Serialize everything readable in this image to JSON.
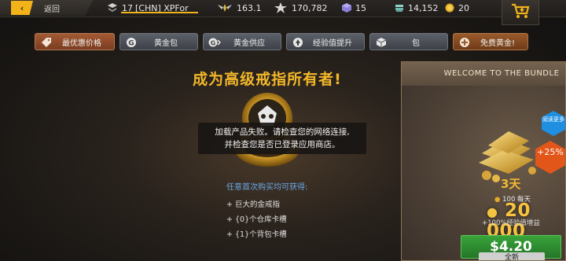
{
  "topbar": {
    "back_label": "返回",
    "player": {
      "level": "17",
      "name": "[CHN] XPFor"
    },
    "rank_value": "163.1",
    "rating_value": "170,782",
    "tickets_value": "15",
    "silver_value": "14,152",
    "gold_value": "20"
  },
  "tabs": [
    {
      "label": "最优惠价格",
      "icon": "sale-tag-icon"
    },
    {
      "label": "黄金包",
      "icon": "gold-coin-g-icon"
    },
    {
      "label": "黄金供应",
      "icon": "gold-supply-icon"
    },
    {
      "label": "经验值提升",
      "icon": "xp-boost-icon"
    },
    {
      "label": "包",
      "icon": "package-box-icon"
    },
    {
      "label": "免费黄金!",
      "icon": "free-gold-icon"
    }
  ],
  "offer": {
    "headline": "成为高级戒指所有者!",
    "error_line1": "加载产品失败。请检查您的网络连接,",
    "error_line2": "并检查您是否已登录应用商店。",
    "benefit_title": "任意首次购买均可获得:",
    "benefits": [
      "+ 巨大的金戒指",
      "+ {0}个仓库卡槽",
      "+ {1}个背包卡槽"
    ]
  },
  "bundle": {
    "header": "WELCOME TO THE BUNDLE",
    "read_more": "阅读更多",
    "bonus_percent": "+25%",
    "days": "3天",
    "daily": "100 每天",
    "gold_amount": "20 000",
    "xp_bonus": "+100%经验值增益",
    "price": "$4.20",
    "new_label": "全新"
  },
  "colors": {
    "accent_gold": "#f2b21a",
    "headline": "#f3b72a",
    "benefit_title": "#6aa8e8",
    "price_green": "#2f9a32",
    "badge_blue": "#1f8fe2",
    "badge_orange": "#e3561a"
  }
}
